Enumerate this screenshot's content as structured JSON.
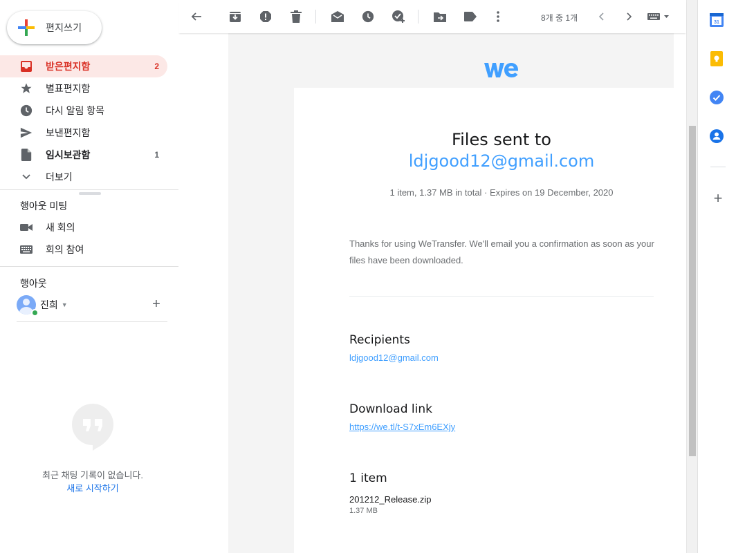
{
  "compose": {
    "label": "편지쓰기"
  },
  "nav": {
    "items": [
      {
        "label": "받은편지함",
        "count": "2",
        "icon": "inbox-icon"
      },
      {
        "label": "별표편지함",
        "count": "",
        "icon": "star-icon"
      },
      {
        "label": "다시 알림 항목",
        "count": "",
        "icon": "clock-icon"
      },
      {
        "label": "보낸편지함",
        "count": "",
        "icon": "send-icon"
      },
      {
        "label": "임시보관함",
        "count": "1",
        "icon": "draft-icon"
      },
      {
        "label": "더보기",
        "count": "",
        "icon": "chevron-down-icon"
      }
    ]
  },
  "meet": {
    "title": "행아웃 미팅",
    "new_meeting": "새 회의",
    "join_meeting": "회의 참여"
  },
  "hangouts": {
    "title": "행아웃",
    "user_name": "진희",
    "empty_text": "최근 채팅 기록이 없습니다.",
    "start_new": "새로 시작하기"
  },
  "toolbar": {
    "pager": "8개 중 1개"
  },
  "email": {
    "brand": "we",
    "title": "Files sent to",
    "recipient": "ldjgood12@gmail.com",
    "meta": "1 item, 1.37 MB in total  ·  Expires on 19 December, 2020",
    "body": "Thanks for using WeTransfer. We'll email you a confirmation as soon as your files have been downloaded.",
    "recipients_heading": "Recipients",
    "recipients_value": "ldjgood12@gmail.com",
    "download_heading": "Download link",
    "download_url": "https://we.tl/t-S7xEm6EXjy",
    "items_heading": "1 item",
    "file_name": "201212_Release.zip",
    "file_size": "1.37 MB"
  },
  "colors": {
    "inbox_active_bg": "#fce8e6",
    "inbox_active_text": "#d93025",
    "wetransfer_blue": "#409fff",
    "link_blue": "#1a73e8"
  }
}
